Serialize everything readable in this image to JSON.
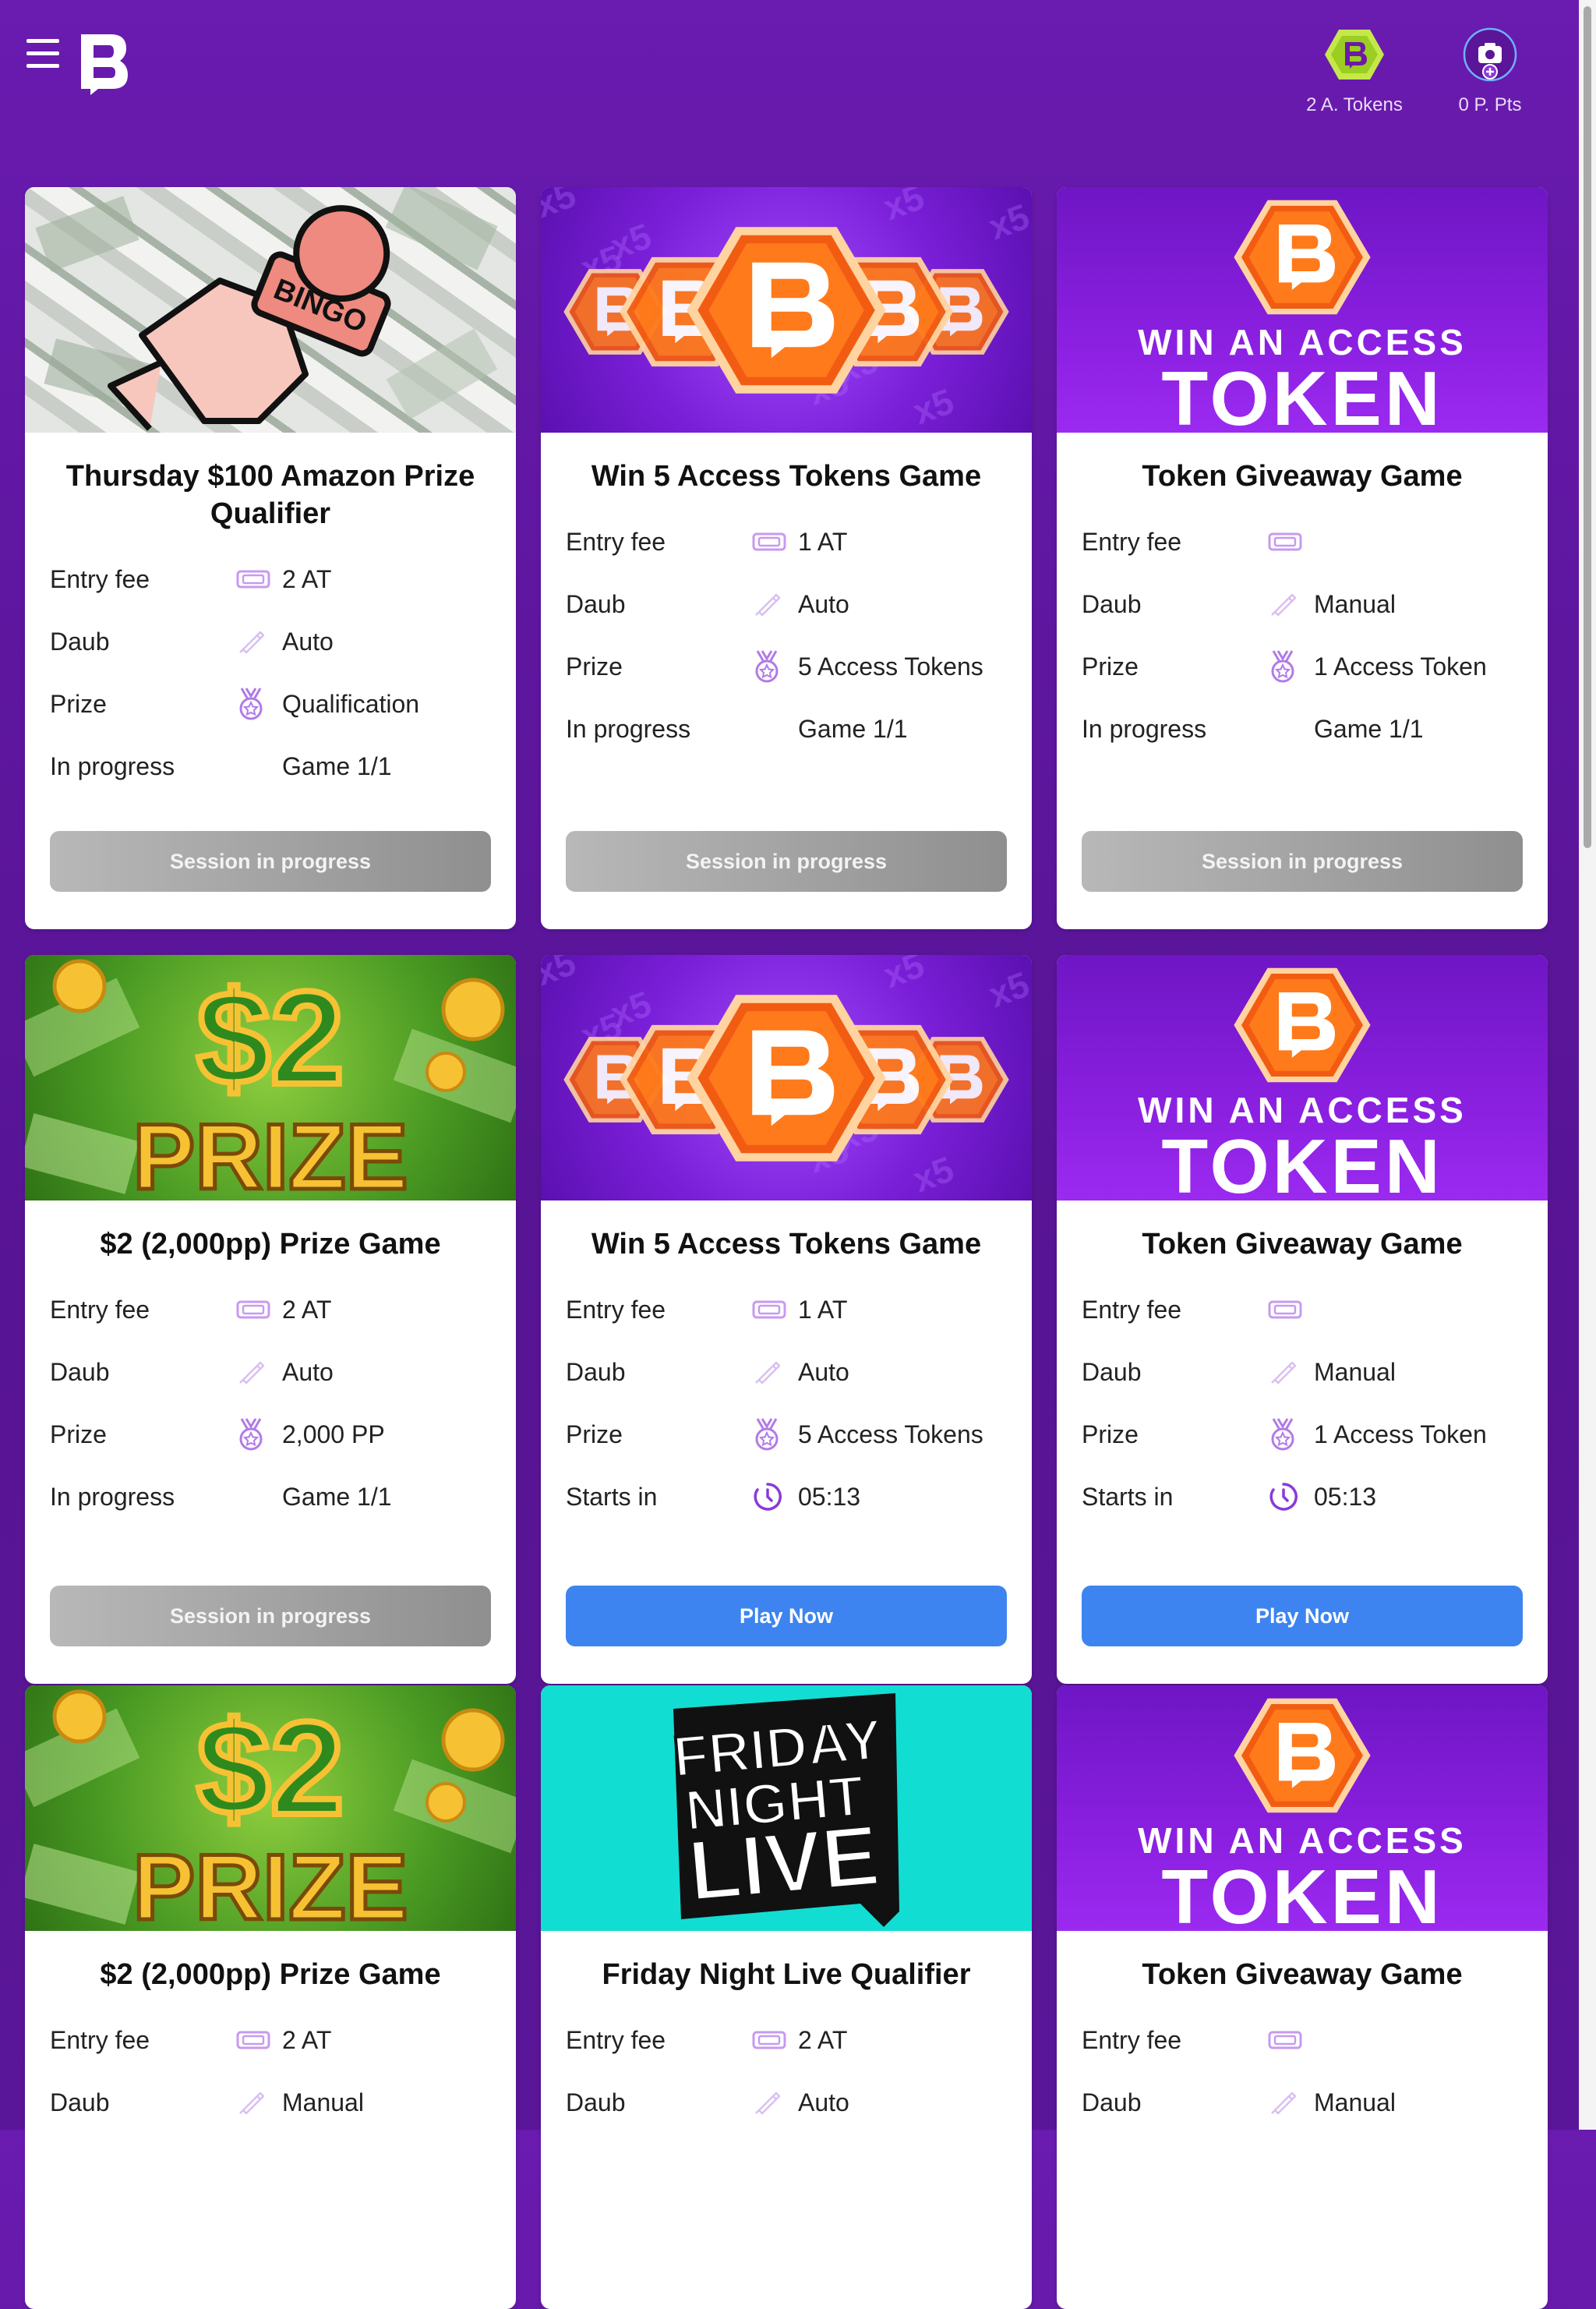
{
  "header": {
    "tokens_label": "2 A. Tokens",
    "points_label": "0 P. Pts"
  },
  "colors": {
    "accent": "#3d84f0",
    "brand_orange": "#f25c12",
    "brand_purple": "#6a1bb0"
  },
  "labels": {
    "entry_fee": "Entry fee",
    "daub": "Daub",
    "prize": "Prize",
    "in_progress": "In progress",
    "starts_in": "Starts in"
  },
  "cards": [
    {
      "banner": "bingo",
      "title": "Thursday $100 Amazon Prize Qualifier",
      "entry_fee": "2 AT",
      "daub": "Auto",
      "prize": "Qualification",
      "status_label": "In progress",
      "status_value": "Game 1/1",
      "button": "Session in progress",
      "button_style": "gray"
    },
    {
      "banner": "win5",
      "title": "Win 5 Access Tokens Game",
      "entry_fee": "1 AT",
      "daub": "Auto",
      "prize": "5 Access Tokens",
      "status_label": "In progress",
      "status_value": "Game 1/1",
      "button": "Session in progress",
      "button_style": "gray"
    },
    {
      "banner": "token",
      "title": "Token Giveaway Game",
      "entry_fee": "",
      "daub": "Manual",
      "prize": "1 Access Token",
      "status_label": "In progress",
      "status_value": "Game 1/1",
      "button": "Session in progress",
      "button_style": "gray"
    },
    {
      "banner": "prize",
      "title": "$2 (2,000pp) Prize Game",
      "entry_fee": "2 AT",
      "daub": "Auto",
      "prize": "2,000 PP",
      "status_label": "In progress",
      "status_value": "Game 1/1",
      "button": "Session in progress",
      "button_style": "gray"
    },
    {
      "banner": "win5",
      "title": "Win 5 Access Tokens Game",
      "entry_fee": "1 AT",
      "daub": "Auto",
      "prize": "5 Access Tokens",
      "status_label": "Starts in",
      "status_value": "05:13",
      "button": "Play Now",
      "button_style": "blue"
    },
    {
      "banner": "token",
      "title": "Token Giveaway Game",
      "entry_fee": "",
      "daub": "Manual",
      "prize": "1 Access Token",
      "status_label": "Starts in",
      "status_value": "05:13",
      "button": "Play Now",
      "button_style": "blue"
    },
    {
      "banner": "prize",
      "title": "$2 (2,000pp) Prize Game",
      "entry_fee": "2 AT",
      "daub": "Manual"
    },
    {
      "banner": "fnl",
      "title": "Friday Night Live Qualifier",
      "entry_fee": "2 AT",
      "daub": "Auto"
    },
    {
      "banner": "token",
      "title": "Token Giveaway Game",
      "entry_fee": "",
      "daub": "Manual"
    }
  ],
  "banner_text": {
    "bingo": "BINGO",
    "token_line1": "WIN AN ACCESS",
    "token_line2": "TOKEN",
    "prize_amount": "$2",
    "prize_word": "PRIZE",
    "fnl_line1": "FRIDAY",
    "fnl_line2": "NIGHT",
    "fnl_line3": "LIVE"
  }
}
